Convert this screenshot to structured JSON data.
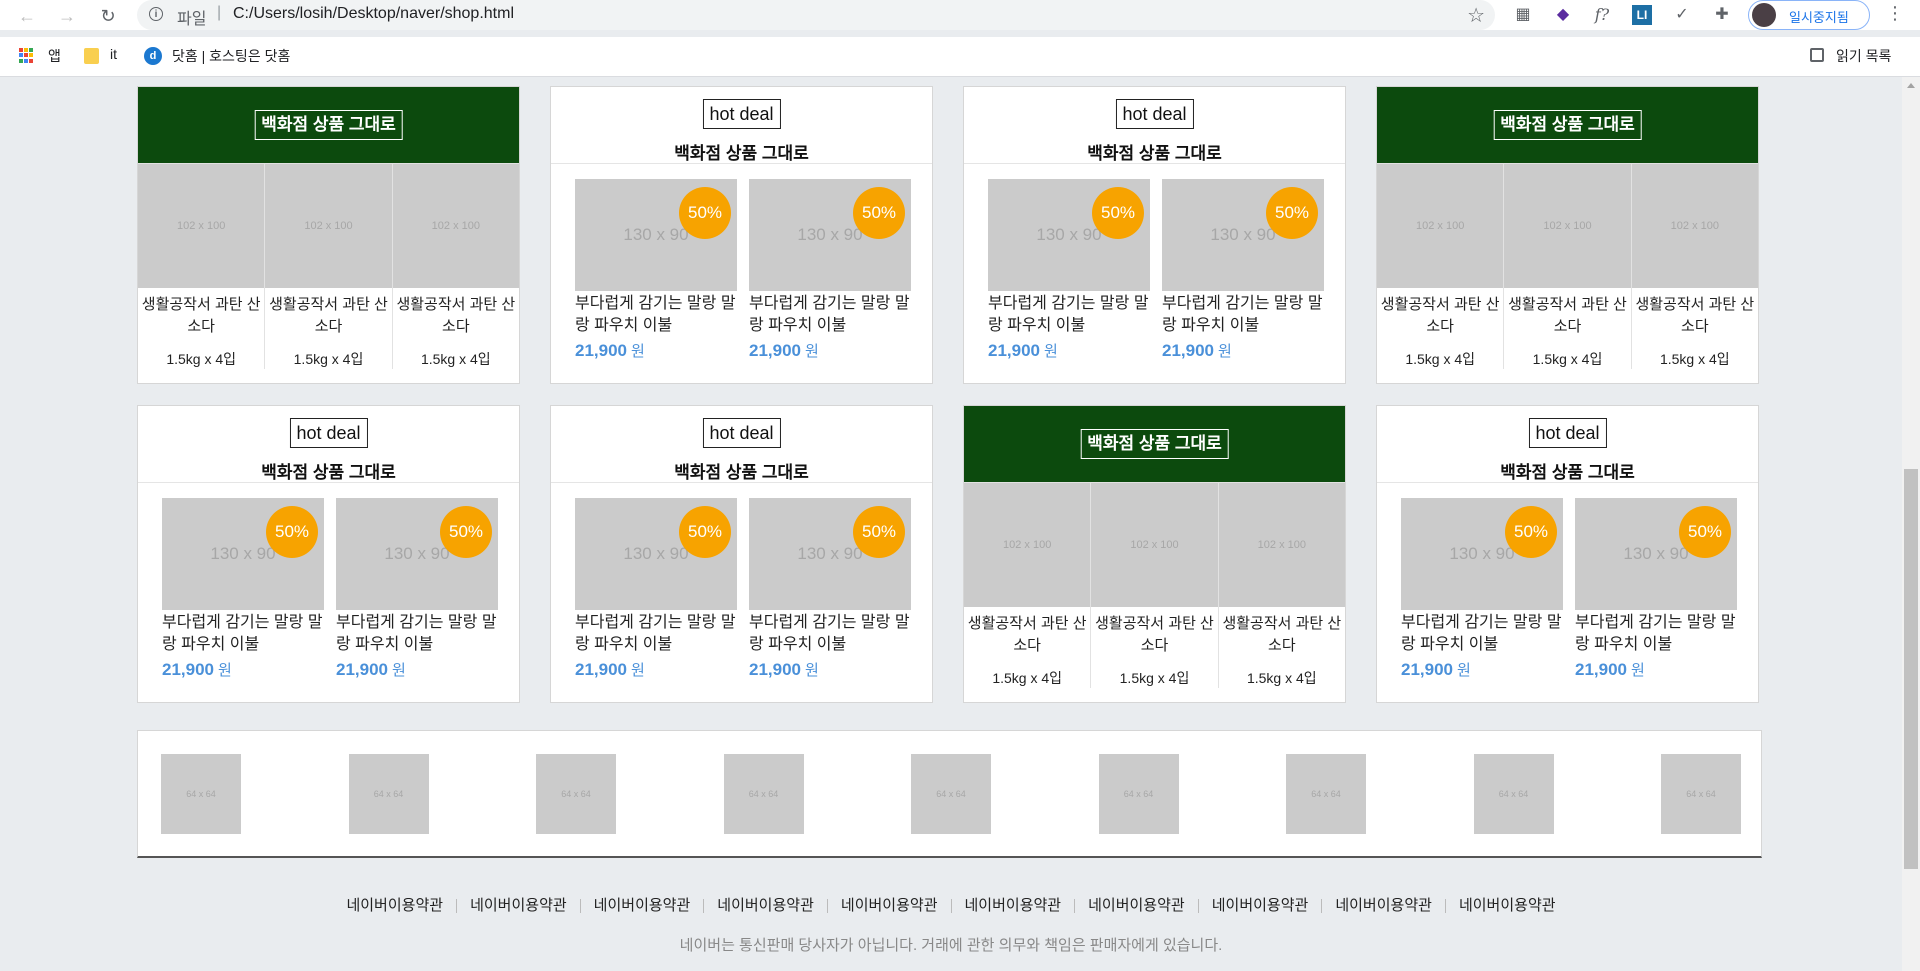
{
  "browser": {
    "scheme": "파일",
    "url": "C:/Users/losih/Desktop/naver/shop.html",
    "profile_label": "일시중지됨",
    "bookmarks": [
      "앱",
      "it",
      "닷홈 | 호스팅은 닷홈"
    ],
    "reading_list": "읽기 목록",
    "ext_f": "f?",
    "ext_li": "LI"
  },
  "cards": [
    {
      "type": "green",
      "title": "백화점 상품 그대로",
      "items": [
        {
          "img": "102 x 100",
          "name": "생활공작서 과탄 산소다",
          "qty": "1.5kg x 4입"
        },
        {
          "img": "102 x 100",
          "name": "생활공작서 과탄 산소다",
          "qty": "1.5kg x 4입"
        },
        {
          "img": "102 x 100",
          "name": "생활공작서 과탄 산소다",
          "qty": "1.5kg x 4입"
        }
      ]
    },
    {
      "type": "hot",
      "badge": "hot deal",
      "title": "백화점 상품 그대로",
      "items": [
        {
          "img": "130 x 90",
          "discount": "50%",
          "name": "부다럽게 감기는 말랑 말랑 파우치 이불",
          "price": "21,900",
          "unit": "원"
        },
        {
          "img": "130 x 90",
          "discount": "50%",
          "name": "부다럽게 감기는 말랑 말랑 파우치 이불",
          "price": "21,900",
          "unit": "원"
        }
      ]
    },
    {
      "type": "hot",
      "badge": "hot deal",
      "title": "백화점 상품 그대로",
      "items": [
        {
          "img": "130 x 90",
          "discount": "50%",
          "name": "부다럽게 감기는 말랑 말랑 파우치 이불",
          "price": "21,900",
          "unit": "원"
        },
        {
          "img": "130 x 90",
          "discount": "50%",
          "name": "부다럽게 감기는 말랑 말랑 파우치 이불",
          "price": "21,900",
          "unit": "원"
        }
      ]
    },
    {
      "type": "green",
      "title": "백화점 상품 그대로",
      "items": [
        {
          "img": "102 x 100",
          "name": "생활공작서 과탄 산소다",
          "qty": "1.5kg x 4입"
        },
        {
          "img": "102 x 100",
          "name": "생활공작서 과탄 산소다",
          "qty": "1.5kg x 4입"
        },
        {
          "img": "102 x 100",
          "name": "생활공작서 과탄 산소다",
          "qty": "1.5kg x 4입"
        }
      ]
    },
    {
      "type": "hot",
      "badge": "hot deal",
      "title": "백화점 상품 그대로",
      "items": [
        {
          "img": "130 x 90",
          "discount": "50%",
          "name": "부다럽게 감기는 말랑 말랑 파우치 이불",
          "price": "21,900",
          "unit": "원"
        },
        {
          "img": "130 x 90",
          "discount": "50%",
          "name": "부다럽게 감기는 말랑 말랑 파우치 이불",
          "price": "21,900",
          "unit": "원"
        }
      ]
    },
    {
      "type": "hot",
      "badge": "hot deal",
      "title": "백화점 상품 그대로",
      "items": [
        {
          "img": "130 x 90",
          "discount": "50%",
          "name": "부다럽게 감기는 말랑 말랑 파우치 이불",
          "price": "21,900",
          "unit": "원"
        },
        {
          "img": "130 x 90",
          "discount": "50%",
          "name": "부다럽게 감기는 말랑 말랑 파우치 이불",
          "price": "21,900",
          "unit": "원"
        }
      ]
    },
    {
      "type": "green",
      "title": "백화점 상품 그대로",
      "items": [
        {
          "img": "102 x 100",
          "name": "생활공작서 과탄 산소다",
          "qty": "1.5kg x 4입"
        },
        {
          "img": "102 x 100",
          "name": "생활공작서 과탄 산소다",
          "qty": "1.5kg x 4입"
        },
        {
          "img": "102 x 100",
          "name": "생활공작서 과탄 산소다",
          "qty": "1.5kg x 4입"
        }
      ]
    },
    {
      "type": "hot",
      "badge": "hot deal",
      "title": "백화점 상품 그대로",
      "items": [
        {
          "img": "130 x 90",
          "discount": "50%",
          "name": "부다럽게 감기는 말랑 말랑 파우치 이불",
          "price": "21,900",
          "unit": "원"
        },
        {
          "img": "130 x 90",
          "discount": "50%",
          "name": "부다럽게 감기는 말랑 말랑 파우치 이불",
          "price": "21,900",
          "unit": "원"
        }
      ]
    }
  ],
  "brands": [
    "64 x 64",
    "64 x 64",
    "64 x 64",
    "64 x 64",
    "64 x 64",
    "64 x 64",
    "64 x 64",
    "64 x 64",
    "64 x 64"
  ],
  "footer": {
    "links": [
      "네이버이용약관",
      "네이버이용약관",
      "네이버이용약관",
      "네이버이용약관",
      "네이버이용약관",
      "네이버이용약관",
      "네이버이용약관",
      "네이버이용약관",
      "네이버이용약관",
      "네이버이용약관"
    ],
    "note": "네이버는 통신판매 당사자가 아닙니다. 거래에 관한 의무와 책임은 판매자에게 있습니다."
  },
  "colors": {
    "green_header": "#0c4a0d",
    "discount": "#f7a300",
    "price": "#4a90d9",
    "placeholder": "#cbcbcb"
  }
}
